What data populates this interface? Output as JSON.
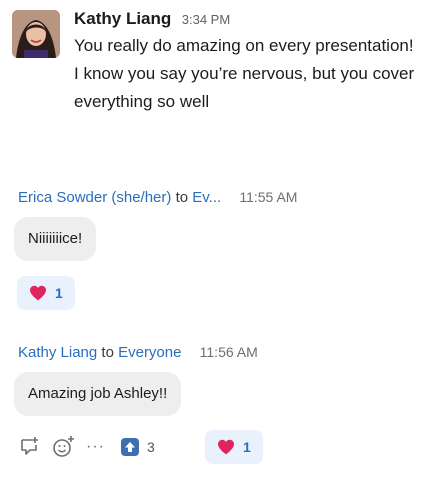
{
  "message1": {
    "sender": "Kathy Liang",
    "time": "3:34 PM",
    "text": "You really do amazing on every presentation! I know you say you’re nervous, but you cover everything so well"
  },
  "chat": [
    {
      "sender": "Erica Sowder (she/her)",
      "to_label": "to",
      "recipient": "Ev...",
      "time": "11:55 AM",
      "text": "Niiiiiiice!",
      "reaction": {
        "icon": "heart-icon",
        "count": "1"
      }
    },
    {
      "sender": "Kathy Liang",
      "to_label": "to",
      "recipient": "Everyone",
      "time": "11:56 AM",
      "text": "Amazing job Ashley!!",
      "actions": {
        "reply_icon": "reply-icon",
        "emoji_icon": "add-emoji-icon",
        "more_label": "···",
        "upvote_icon": "upvote-icon",
        "upvote_count": "3",
        "reaction": {
          "icon": "heart-icon",
          "count": "1"
        }
      }
    }
  ],
  "colors": {
    "link": "#2a6ebd",
    "bubble": "#eeeeef",
    "reaction_bg": "#e8f1fc",
    "heart": "#e0245e",
    "upvote": "#3b6fb0"
  }
}
